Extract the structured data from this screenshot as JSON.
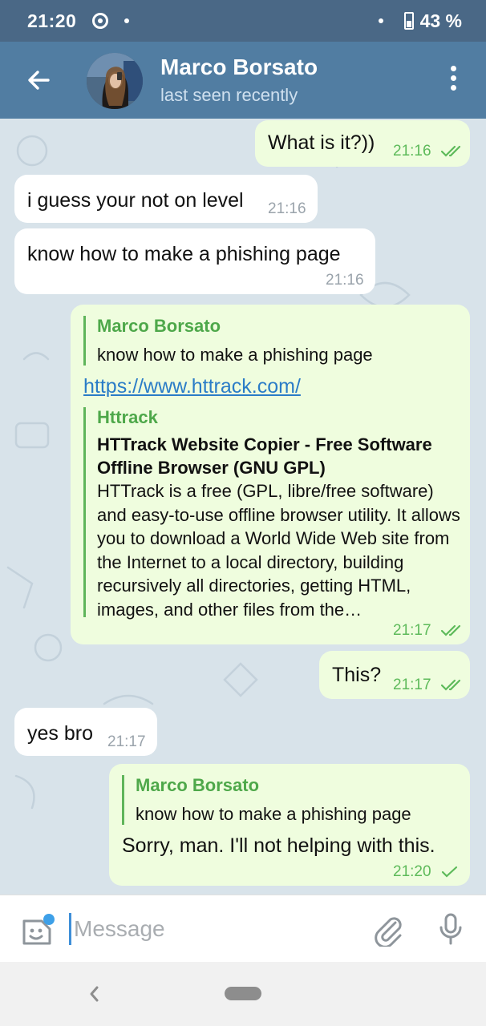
{
  "status_bar": {
    "time": "21:20",
    "battery": "43 %"
  },
  "header": {
    "name": "Marco Borsato",
    "status": "last seen recently"
  },
  "messages": [
    {
      "dir": "out",
      "text": "What is it?))",
      "time": "21:16",
      "read": "double"
    },
    {
      "dir": "in",
      "text": "i guess your not on level",
      "time": "21:16"
    },
    {
      "dir": "in",
      "text": "know how to make a phishing page",
      "time": "21:16"
    },
    {
      "dir": "out",
      "reply_name": "Marco Borsato",
      "reply_text": "know how to make a phishing page",
      "link": "https://www.httrack.com/",
      "preview_site": "Httrack",
      "preview_title": "HTTrack Website Copier - Free Software Offline Browser (GNU GPL)",
      "preview_desc": "HTTrack is a free (GPL, libre/free software) and easy-to-use offline browser utility. It allows you to download a World Wide Web site from the Internet to a local directory, building recursively all directories, getting HTML, images, and other files from the…",
      "time": "21:17",
      "read": "double"
    },
    {
      "dir": "out",
      "text": "This?",
      "time": "21:17",
      "read": "double"
    },
    {
      "dir": "in",
      "text": "yes bro",
      "time": "21:17"
    },
    {
      "dir": "out",
      "reply_name": "Marco Borsato",
      "reply_text": "know how to make a phishing page",
      "text": "Sorry, man. I'll not helping with this.",
      "time": "21:20",
      "read": "single"
    }
  ],
  "input": {
    "placeholder": "Message"
  },
  "icons": {
    "back": "arrow-left-icon",
    "menu": "more-vertical-icon",
    "emoji": "sticker-emoji-icon",
    "attach": "paperclip-icon",
    "mic": "microphone-icon",
    "checks": "double-check-icon"
  },
  "colors": {
    "status_bar": "#4a6886",
    "app_bar": "#517da2",
    "chat_bg": "#d8e3ea",
    "bubble_in": "#ffffff",
    "bubble_out": "#effdde",
    "accent_green": "#5dba5a",
    "link": "#2a7cc7"
  }
}
